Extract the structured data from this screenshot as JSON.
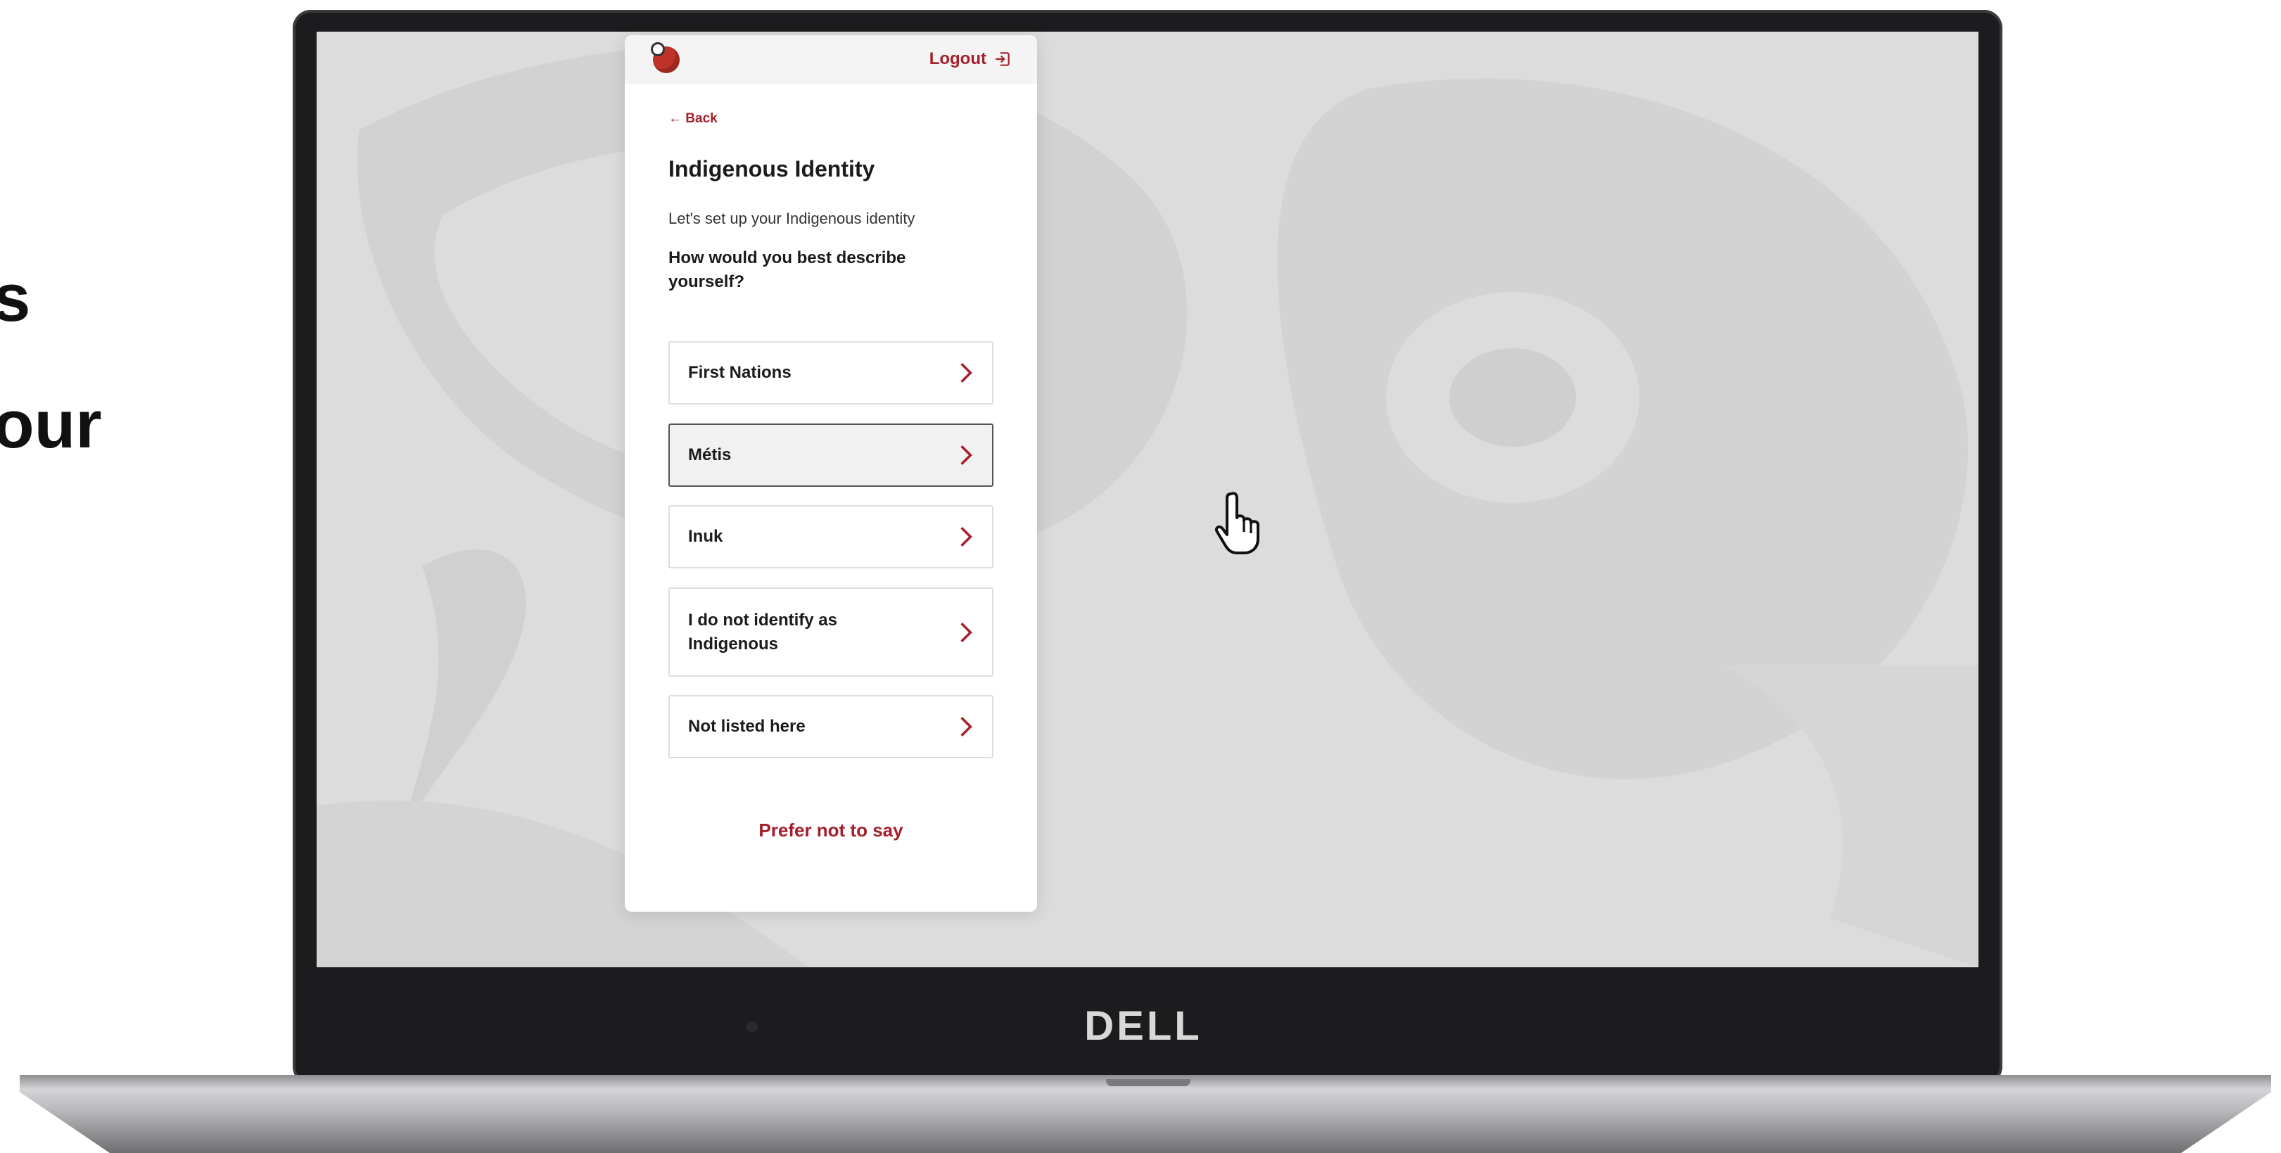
{
  "side_text": {
    "line1": "s",
    "line2": "our"
  },
  "device": {
    "brand": "DELL"
  },
  "app": {
    "logout_label": "Logout",
    "back_label": "← Back",
    "title": "Indigenous Identity",
    "subtitle": "Let's set up your Indigenous identity",
    "question": "How would you best describe yourself?",
    "options": [
      {
        "label": "First Nations",
        "hovered": false
      },
      {
        "label": "Métis",
        "hovered": true
      },
      {
        "label": "Inuk",
        "hovered": false
      },
      {
        "label": "I do not identify as Indigenous",
        "hovered": false
      },
      {
        "label": "Not listed here",
        "hovered": false
      }
    ],
    "prefer_not_label": "Prefer not to say"
  },
  "icons": {
    "logo": "apple-logo-icon",
    "logout": "logout-icon",
    "chevron": "chevron-right-icon",
    "cursor": "hand-pointer-cursor"
  },
  "colors": {
    "accent": "#a4202c",
    "screen_bg": "#dcdcdc",
    "card_bg": "#ffffff",
    "hover_bg": "#f1f1f1"
  }
}
